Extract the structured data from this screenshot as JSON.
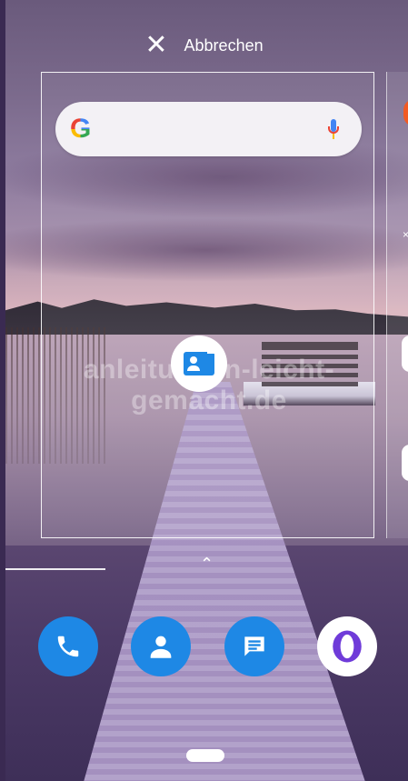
{
  "top_bar": {
    "cancel_label": "Abbrechen",
    "cancel_icon": "close-icon"
  },
  "recent_card": {
    "search_widget": {
      "logo_icon": "google-g-icon",
      "mic_icon": "mic-icon"
    },
    "app_icon": "contacts-card-icon"
  },
  "watermark": {
    "text": "anleitungen-leicht-gemacht.de"
  },
  "dock": {
    "items": [
      {
        "name": "phone",
        "icon": "phone-icon",
        "color": "#1e88e5"
      },
      {
        "name": "contacts",
        "icon": "contacts-icon",
        "color": "#1e88e5"
      },
      {
        "name": "messages",
        "icon": "messages-icon",
        "color": "#1e88e5"
      },
      {
        "name": "opera",
        "icon": "opera-icon",
        "color": "#6f3bd9"
      }
    ]
  },
  "colors": {
    "google_blue": "#4285f4",
    "google_red": "#ea4335",
    "google_yellow": "#fbbc05",
    "google_green": "#34a853",
    "accent_blue": "#1e88e5"
  }
}
